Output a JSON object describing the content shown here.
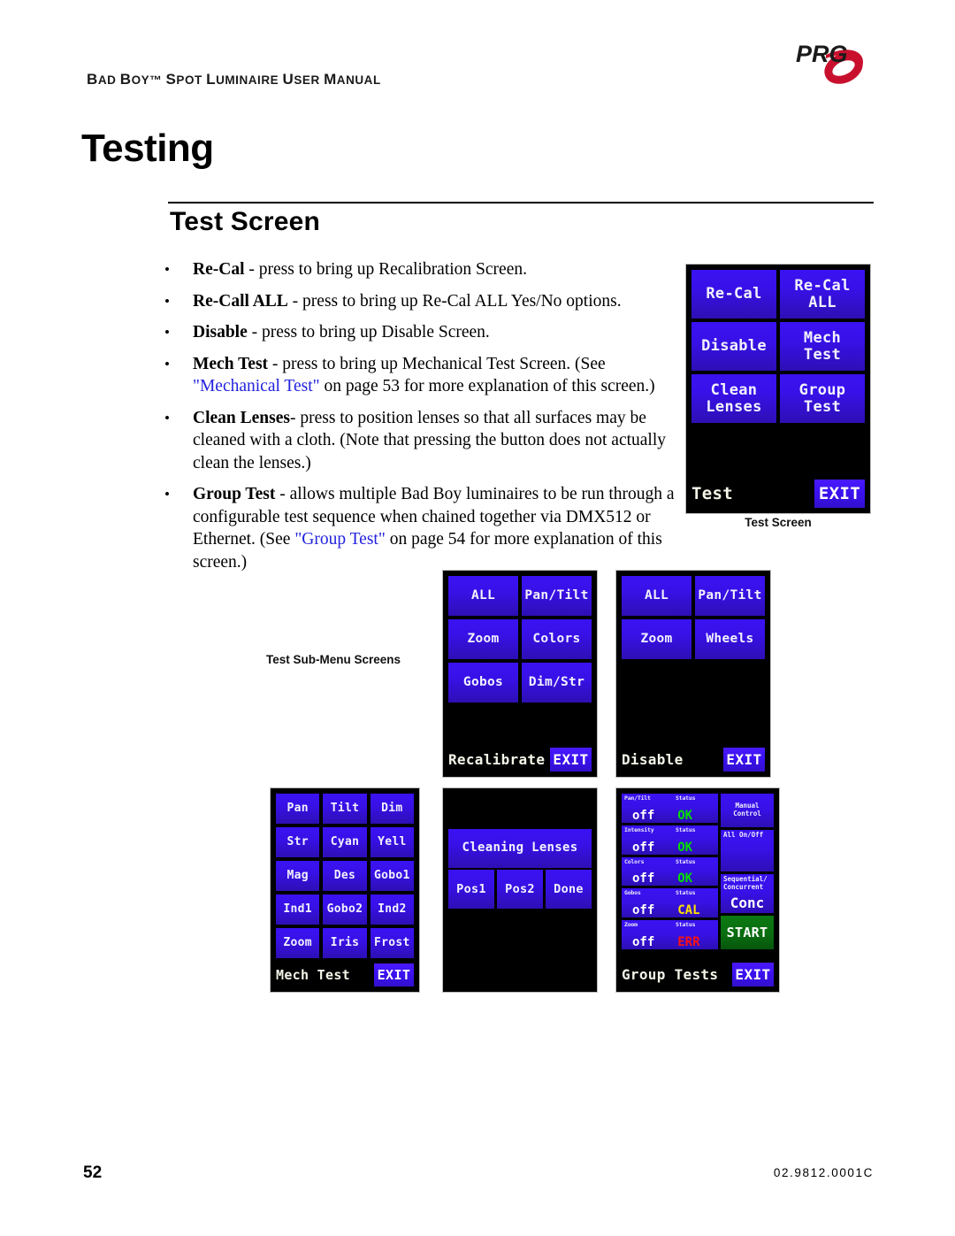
{
  "header": {
    "title_prefix": "B",
    "title": "BAD BOY™ SPOT LUMINAIRE USER MANUAL",
    "logo_text": "PRG",
    "logo_accent": "#c8102e"
  },
  "page_title": "Testing",
  "section_title": "Test Screen",
  "bullets": [
    {
      "term": "Re-Cal",
      "text": " - press to bring up Recalibration Screen."
    },
    {
      "term": "Re-Call ALL",
      "text": " - press to bring up Re-Cal ALL Yes/No options."
    },
    {
      "term": "Disable",
      "text": " - press to bring up Disable Screen."
    },
    {
      "term": "Mech Test",
      "text": " - press to bring up Mechanical Test Screen. (See ",
      "link": "\"Mechanical Test\"",
      "text_after": " on page 53 for more explanation of this screen.)"
    },
    {
      "term": "Clean Lenses",
      "text": "- press to position lenses so that all surfaces may be cleaned with a cloth. (Note that pressing the button does not actually clean the lenses.)"
    },
    {
      "term": "Group Test",
      "text": " - allows multiple Bad Boy luminaires to be run through a configurable test sequence when chained together via DMX512 or Ethernet. (See ",
      "link": "\"Group Test\"",
      "text_after": " on page 54 for more explanation of this screen.)"
    }
  ],
  "captions": {
    "test_screen": "Test Screen",
    "sub_menu": "Test Sub-Menu Screens"
  },
  "panels": {
    "test": {
      "buttons": [
        "Re-Cal",
        "Re-Cal\nALL",
        "Disable",
        "Mech\nTest",
        "Clean\nLenses",
        "Group\nTest"
      ],
      "screen_name": "Test",
      "exit_label": "EXIT"
    },
    "recalibrate": {
      "buttons": [
        "ALL",
        "Pan/Tilt",
        "Zoom",
        "Colors",
        "Gobos",
        "Dim/Str"
      ],
      "screen_name": "Recalibrate",
      "exit_label": "EXIT"
    },
    "disable": {
      "buttons": [
        "ALL",
        "Pan/Tilt",
        "Zoom",
        "Wheels"
      ],
      "screen_name": "Disable",
      "exit_label": "EXIT"
    },
    "mech_test": {
      "buttons": [
        "Pan",
        "Tilt",
        "Dim",
        "Str",
        "Cyan",
        "Yell",
        "Mag",
        "Des",
        "Gobo1",
        "Ind1",
        "Gobo2",
        "Ind2",
        "Zoom",
        "Iris",
        "Frost"
      ],
      "screen_name": "Mech Test",
      "exit_label": "EXIT"
    },
    "clean_lenses": {
      "banner": "Cleaning Lenses",
      "buttons": [
        "Pos1",
        "Pos2",
        "Done"
      ]
    },
    "group_tests": {
      "rows": [
        {
          "label": "Pan/Tilt",
          "status_label": "Status",
          "value": "off",
          "status": "OK",
          "status_color": "#00e000"
        },
        {
          "label": "Intensity",
          "status_label": "Status",
          "value": "off",
          "status": "OK",
          "status_color": "#00e000"
        },
        {
          "label": "Colors",
          "status_label": "Status",
          "value": "off",
          "status": "OK",
          "status_color": "#00e000"
        },
        {
          "label": "Gobos",
          "status_label": "Status",
          "value": "off",
          "status": "CAL",
          "status_color": "#ffe000"
        },
        {
          "label": "Zoom",
          "status_label": "Status",
          "value": "off",
          "status": "ERR",
          "status_color": "#ff1111"
        }
      ],
      "side": {
        "manual_control": "Manual\nControl",
        "all_on_off": "All On/Off",
        "seq_conc_label": "Sequential/\nConcurrent",
        "seq_conc_value": "Conc",
        "start": "START",
        "start_color": "#0a6d10"
      },
      "screen_name": "Group Tests",
      "exit_label": "EXIT"
    }
  },
  "footer": {
    "page_number": "52",
    "doc_number": "02.9812.0001C"
  }
}
